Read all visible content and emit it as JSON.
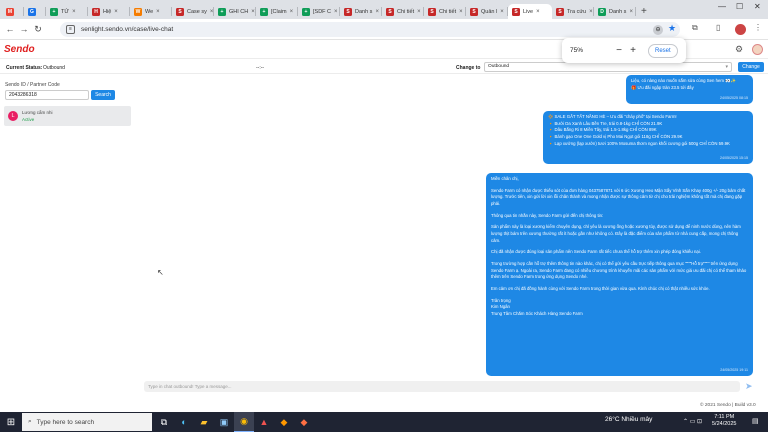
{
  "browser": {
    "tabs": [
      {
        "label": "",
        "color": "#ea4335",
        "glyph": "M",
        "active": false
      },
      {
        "label": "",
        "color": "#1a73e8",
        "glyph": "G",
        "active": false
      },
      {
        "label": "TỬ",
        "color": "#0f9d58",
        "glyph": "+",
        "active": false
      },
      {
        "label": "Hiệ",
        "color": "#c62828",
        "glyph": "H",
        "active": false
      },
      {
        "label": "We",
        "color": "#f57c00",
        "glyph": "W",
        "active": false
      },
      {
        "label": "Case sy",
        "color": "#c62828",
        "glyph": "S",
        "active": false
      },
      {
        "label": "GHI CH",
        "color": "#0f9d58",
        "glyph": "+",
        "active": false
      },
      {
        "label": "[Claim",
        "color": "#0f9d58",
        "glyph": "+",
        "active": false
      },
      {
        "label": "[SDF C",
        "color": "#0f9d58",
        "glyph": "+",
        "active": false
      },
      {
        "label": "Danh s",
        "color": "#c62828",
        "glyph": "S",
        "active": false
      },
      {
        "label": "Chi tiết",
        "color": "#c62828",
        "glyph": "S",
        "active": false
      },
      {
        "label": "Chi tiết",
        "color": "#c62828",
        "glyph": "S",
        "active": false
      },
      {
        "label": "Quản l",
        "color": "#c62828",
        "glyph": "S",
        "active": false
      },
      {
        "label": "Live",
        "color": "#c62828",
        "glyph": "S",
        "active": true
      },
      {
        "label": "Tra cứu",
        "color": "#c62828",
        "glyph": "S",
        "active": false
      },
      {
        "label": "Danh s",
        "color": "#0f9d58",
        "glyph": "D",
        "active": false
      }
    ],
    "url": "senlight.sendo.vn/case/live-chat"
  },
  "zoom": {
    "percent": "75%",
    "reset_label": "Reset"
  },
  "header": {
    "logo": "Sendo"
  },
  "status_bar": {
    "current_status_label": "Current Status:",
    "current_status_value": "Outbound",
    "middle_text": "--:--",
    "change_to_label": "Change to",
    "change_to_value": "Outbound",
    "change_button": "Change"
  },
  "left_panel": {
    "search_label": "Sendo ID / Partner Code",
    "search_value": "2043286318",
    "search_button": "Search",
    "conversation": {
      "initial": "L",
      "name": "Lương cẩm nhi",
      "status": "Active"
    }
  },
  "chat": {
    "messages": [
      {
        "lines": [
          "Liệu, có nàng nào muốn sắm sửa cùng Sen hem 👀✨",
          "🎁 Ưu đãi ngập tràn 23.5 tới đây"
        ],
        "time": "24/05/2025 08:15"
      },
      {
        "lines": [
          "🔆 SALE GẮT TẤT NẮNG HÈ – Ưu đãi \"cháy phố\" tại Sendo Farm!",
          "🔸 Bưởi Da Xanh Lâu Bền Tre, trái 0.8-1kg CHỈ CÒN 21.9K",
          "🔸 Dâu Bắng Ri 8 Miền Tây, trái 1.5-1.8kg CHỈ CÒN 89K",
          "🔸 Bánh gạo One One Gold vị Pho Mai Ngọt gói 118g CHỈ CÒN 29.9K",
          "🔸 Lạp xưởng (lạp xưởn) tươi 100% Mosuma thơm ngon khối cương gói 500g CHỈ CÒN 59.9K"
        ],
        "time": "24/05/2025 15:15"
      },
      {
        "lines": [
          "Miền chân chị,",
          "",
          "Sendo Farm có nhận được thiếu sót của đơn hàng 0437587871 với 6 ức Xương Heo Mận Sấy Vỉnh Sấn Khay 400g +/- 20g bảm chất lượng. Trước tiên, xin gửi lời xin lỗi chân thành và mong nhận được sự thông cảm từ chị cho trải nghiệm không tốt mà chị đang gặp phải.",
          "",
          "Thông qua tin nhắn này, Sendo Farm gửi đến chị thông tin:",
          "",
          "Sản phẩm này là loại xương kiểm chuyên dụng, chỉ yêu là xương ống hoặc xương tủy, được sử dụng để ninh nước dùng, nên hàm lượng thịt bám trên xương thường rất ít hoặc gần như không có. Đây là đặc điểm của sản phẩm từ nhà cung cấp, mong chị thông cảm.",
          "",
          "Chị đã nhận được đúng loại sản phẩm nên  Sendo Farm rất tiếc chưa thể hỗ trợ thêm xin phép đóng khiếu nại.",
          "",
          "Trong trường hợp cần hỗ trợ thêm thông tin nào khác, chị có thể gửi yêu cầu trực tiếp thông qua mục \"\"\"\"Hỗ trợ\"\"\"\" trên ứng dụng Sendo Farm ạ. Ngoài ra, Sendo Farm đang có nhiều chương trình khuyến mãi các sản phẩm với mức giá ưu đãi chị có thể tham khảo thêm trên Sendo Farm trong ứng dụng Sendo nhé.",
          "",
          "Em cảm ơn chị đã đồng hành cùng với Sendo Farm trong thời gian vừa qua. Kính chúc chị có thật nhiều sức khỏe.",
          "",
          "Trân trọng",
          "Kim Ngân",
          "Trung Tâm Chăm Sóc Khách Hàng Sendo Farm"
        ],
        "time": "24/05/2025 19:11"
      }
    ],
    "input_placeholder": "Type in chat outbound! Type a message..."
  },
  "footer": {
    "text": "© 2021 Sendo | Build v3.0"
  },
  "taskbar": {
    "search_placeholder": "Type here to search",
    "weather": "26°C  Nhiều mây",
    "time": "7:11 PM",
    "date": "5/24/2025"
  },
  "colors": {
    "primary": "#1e88e5",
    "brand": "#e02020",
    "taskbar": "#1f2433"
  }
}
